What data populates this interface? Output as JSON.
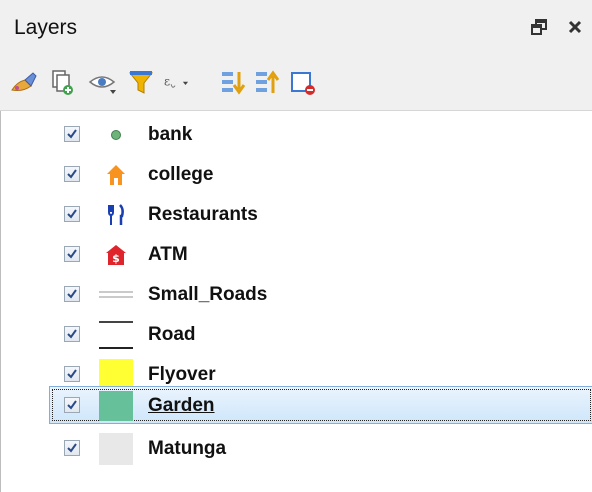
{
  "panel": {
    "title": "Layers",
    "float_icon": "float-window-icon",
    "close_icon": "close-icon"
  },
  "toolbar": {
    "icons": [
      "style-manager-icon",
      "add-group-icon",
      "manage-map-themes-icon",
      "filter-legend-icon",
      "filter-by-expression-icon",
      "expand-all-icon",
      "collapse-all-icon",
      "remove-layer-icon"
    ]
  },
  "layers": [
    {
      "name": "bank",
      "checked": true,
      "symbol": "circle-marker",
      "color": "#6db37a"
    },
    {
      "name": "college",
      "checked": true,
      "symbol": "house-marker",
      "color": "#f7931e"
    },
    {
      "name": "Restaurants",
      "checked": true,
      "symbol": "fork-knife-marker",
      "color": "#1a3fb0"
    },
    {
      "name": "ATM",
      "checked": true,
      "symbol": "dollar-house-marker",
      "color": "#e0242b"
    },
    {
      "name": "Small_Roads",
      "checked": true,
      "symbol": "double-line",
      "color": "#b9b9b9"
    },
    {
      "name": "Road",
      "checked": true,
      "symbol": "single-line",
      "color": "#222222"
    },
    {
      "name": "Flyover",
      "checked": true,
      "symbol": "fill-square",
      "color": "#ffff33"
    },
    {
      "name": "Garden",
      "checked": true,
      "symbol": "fill-square",
      "color": "#66c09a",
      "selected": true
    },
    {
      "name": "Matunga",
      "checked": true,
      "symbol": "fill-square",
      "color": "#e8e8e8"
    }
  ]
}
